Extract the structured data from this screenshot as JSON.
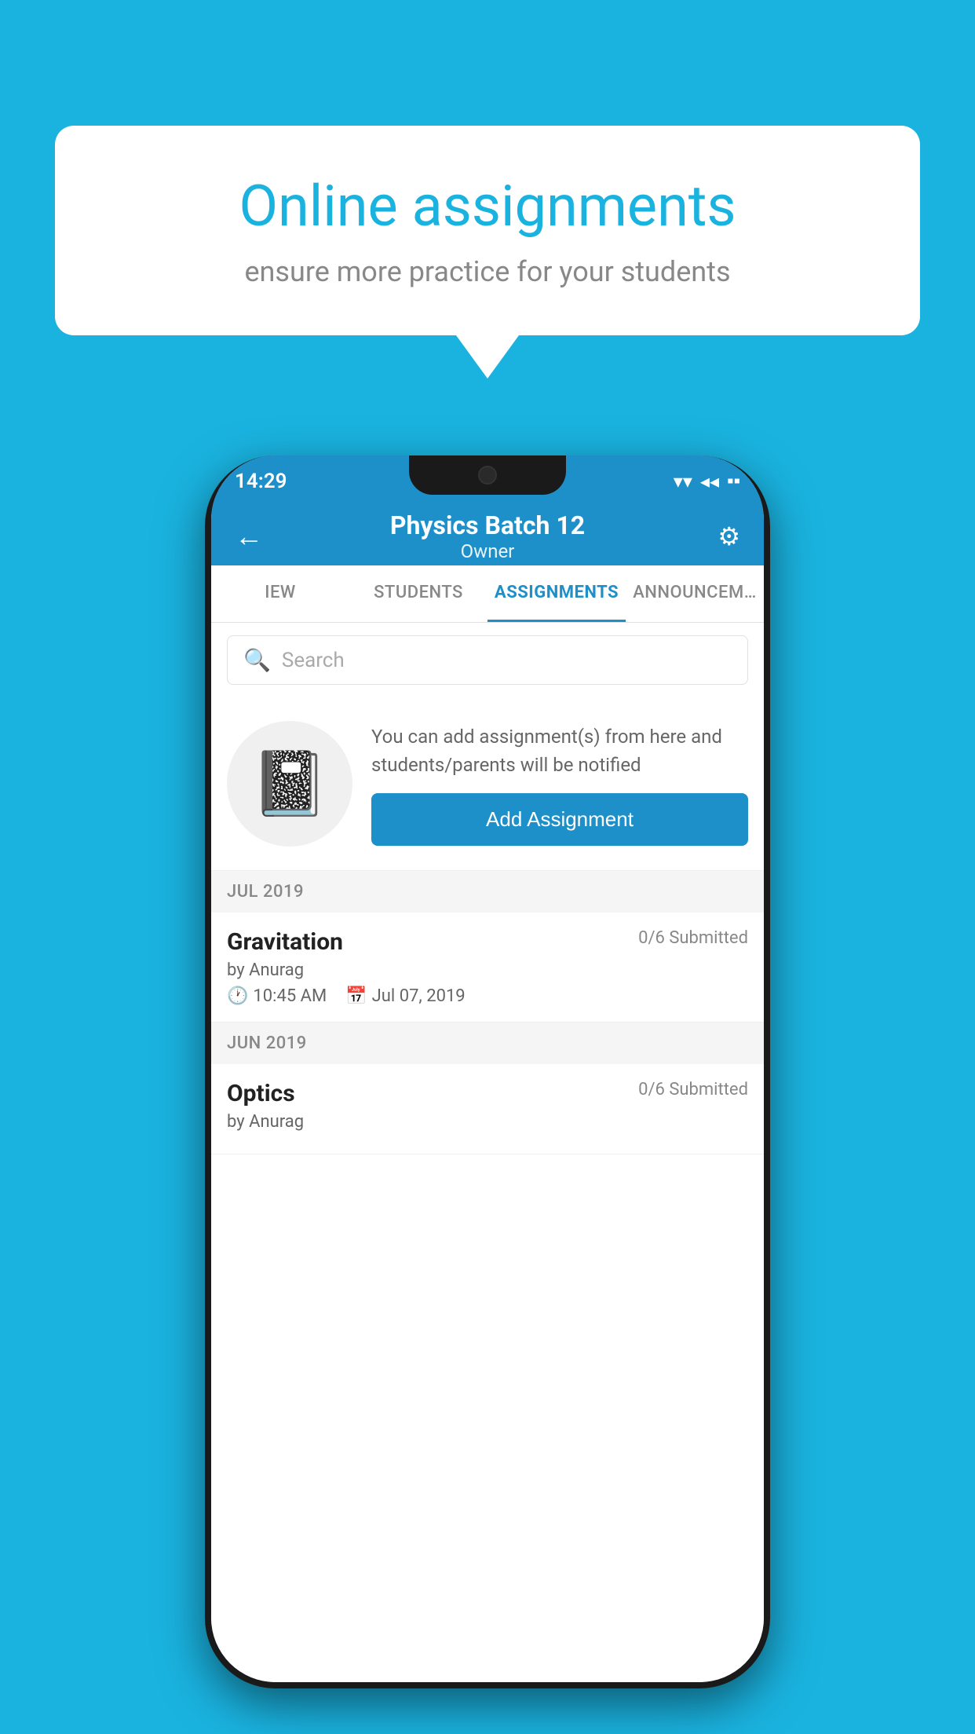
{
  "background_color": "#1ab3e0",
  "speech_bubble": {
    "title": "Online assignments",
    "subtitle": "ensure more practice for your students"
  },
  "status_bar": {
    "time": "14:29",
    "wifi_icon": "▼",
    "signal_icon": "◀",
    "battery_icon": "▪"
  },
  "header": {
    "title": "Physics Batch 12",
    "subtitle": "Owner",
    "back_label": "←",
    "settings_label": "⚙"
  },
  "tabs": [
    {
      "label": "IEW",
      "active": false
    },
    {
      "label": "STUDENTS",
      "active": false
    },
    {
      "label": "ASSIGNMENTS",
      "active": true
    },
    {
      "label": "ANNOUNCEM...",
      "active": false
    }
  ],
  "search": {
    "placeholder": "Search"
  },
  "add_assignment": {
    "description": "You can add assignment(s) from here and students/parents will be notified",
    "button_label": "Add Assignment"
  },
  "sections": [
    {
      "label": "JUL 2019",
      "assignments": [
        {
          "name": "Gravitation",
          "submitted": "0/6 Submitted",
          "by": "by Anurag",
          "time": "10:45 AM",
          "date": "Jul 07, 2019"
        }
      ]
    },
    {
      "label": "JUN 2019",
      "assignments": [
        {
          "name": "Optics",
          "submitted": "0/6 Submitted",
          "by": "by Anurag",
          "time": "",
          "date": ""
        }
      ]
    }
  ]
}
